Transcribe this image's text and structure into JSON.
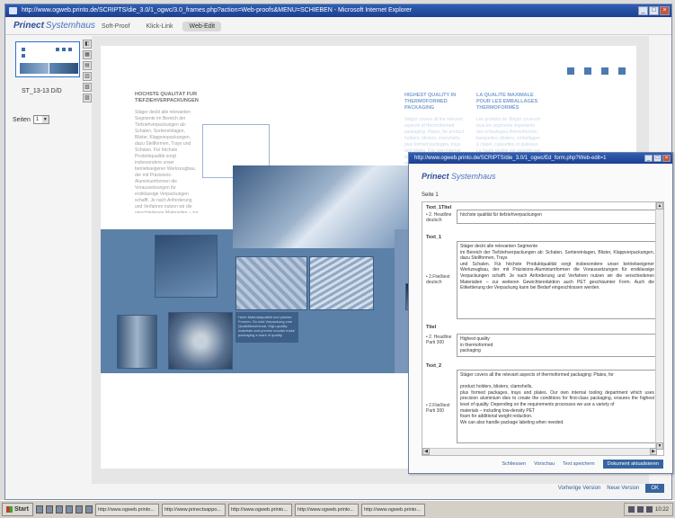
{
  "main_window": {
    "title": "http://www.ogweb.printo.de/SCRIPTS/die_3.0/1_ogwc/3.0_frames.php?action=Web-proofs&MENU=SCHIEBEN - Microsoft Internet Explorer",
    "controls": [
      "_",
      "□",
      "×"
    ]
  },
  "app": {
    "logo_main": "Prinect",
    "logo_sub": "Systemhaus",
    "tabs": [
      "Soft-Proof",
      "Klick-Link",
      "Web-Edit"
    ],
    "active_tab": "Web-Edit"
  },
  "sidebar": {
    "page_label": "ST_13-13 D/D",
    "seiten_label": "Seiten",
    "seiten_value": "1",
    "tools": [
      "◧",
      "▦",
      "▤",
      "▥",
      "▧",
      "▨"
    ]
  },
  "document": {
    "col1_heading": "HÖCHSTE QUALITÄT FÜR TIEFZIEHVERPACKUNGEN",
    "col1_text": "Stäger deckt alle relevanten Segmente im Bereich der Tiefziehverpackungen ab: Schalen, Sortiereinlagen, Blister, Klappverpackungen, dazu Stellformen, Trays und Schalen. Für höchste Produktqualität sorgt insbesondere unser betriebseigener Werkzeugbau, der mit Präzisions-Aluminiumformen die Voraussetzungen für erstklassige Verpackungen schafft. Je nach Anforderung und Verfahren nutzen wir die verschiedenen Materialien – zur weiteren Gewichtsreduktion auch PET geschäumter Form. Auch die Etikettierung der Verpackung kann bei Bedarf eingeschlossen werden.",
    "col2_heading": "HIGHEST QUALITY IN THERMOFORMED PACKAGING",
    "col2_text": "Stäger covers all the relevant aspects of thermoformed packaging: Plates, for product holders, blisters, clamshells, plus formed packages, trays and plates. Our own internal tooling department which uses precision aluminium dies to create the conditions for first-class packaging.",
    "col3_heading": "LA QUALITÉ MAXIMALE POUR LES EMBALLAGES THERMOFORMÉS",
    "col3_text": "Les produits de Stäger couvrent tous les segments importants des emballages thermoformés : barquettes, blisters, emballages à clapet, caissettes et plateaux. La haute qualité est assurée par notre propre atelier de construction.",
    "caption_text": "Hohe Materialqualität und präzise Formen: So wird Verpackung zum Qualitätsmerkmal. High-quality materials and precise moulds make packaging a mark of quality."
  },
  "main_bottom": {
    "prev": "Vorherige Version",
    "next": "Neue Version",
    "ok": "OK"
  },
  "popup": {
    "title": "http://www.ogweb.printo.de/SCRIPTS/die_3.0/1_ogwc/Ed_form.php?Web-edit=1",
    "logo_main": "Prinect",
    "logo_sub": "Systemhaus",
    "seite_label": "Seite 1",
    "groups": [
      {
        "title": "Text_1Titel",
        "side": "• 2. Headline deutsch",
        "value": "höchste qualität für tiefziehverpackungen"
      },
      {
        "title": "Text_1",
        "side": "• 2.Fließtext deutsch",
        "value": "Stäger deckt alle relevanten Segmente\nim Bereich der Tiefziehverpackungen ab: Schalen, Sortiereinlagen, Blister, Klappverpackungen, dazu Stellformen, Trays\nund Schalen. Für höchste Produktqualität sorgt insbesondere unser betriebseigener Werkzeugbau, der mit Präzisions-Aluminiumformen die Voraussetzungen für erstklassige Verpackungen schafft. Je nach Anforderung und Verfahren nutzen wir die verschiedenen Materialien – zur weiteren Gewichtsreduktion auch PET geschäumter Form. Auch die Etikettierung der Verpackung kann bei Bedarf eingeschlossen werden."
      },
      {
        "title": "Titel",
        "side": "• 2. Headline Parti 300",
        "value": "Highest quality\nin thermoformed\npackaging"
      },
      {
        "title": "Text_2",
        "side": "• 2.Fließtext Parti 300",
        "value": "Stäger covers all the relevant aspects of thermoformed packaging: Plates, for\n\nproduct holders, blisters, clamshells,\nplus formed packages, trays and plates. Our own internal tooling department which uses precision aluminium dies to create the conditions for first-class packaging, ensures the highest level of quality. Depending on the requirements processes we use a variety of\nmaterials – including low-density PET\nfoam for additional weight reduction.\nWe can also handle package labeling when needed."
      }
    ],
    "footer": {
      "close": "Schliessen",
      "preview": "Vorschau",
      "save": "Text speichern",
      "update": "Dokument aktualisieren"
    }
  },
  "taskbar": {
    "start": "Start",
    "tasks": [
      "http://www.ogweb.printo...",
      "http://www.prinectsappo...",
      "http://www.ogweb.printo...",
      "http://www.ogweb.printo...",
      "http://www.ogweb.printo..."
    ],
    "clock": "10:22"
  },
  "colors": {
    "accent": "#36649f",
    "titlebar": "#2f5fb4",
    "photo_blue": "#5c81a8"
  }
}
